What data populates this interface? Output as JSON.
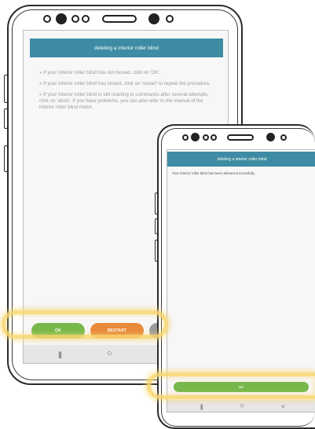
{
  "back_phone": {
    "header_title": "deleting a interior roller blind",
    "instructions": [
      "» If your interior roller blind has not moved, click on 'OK'.",
      "» If your interior roller blind has closed, click on 'restart' to repeat the procedure.",
      "» If your interior roller blind is still reacting to commands after several attempts, click on 'abort'. If you have problems, you can also refer to the manual of the interior roller blind motor."
    ],
    "ok_label": "OK",
    "restart_label": "RESTART",
    "nav": {
      "recent": "|||",
      "home": "○"
    }
  },
  "front_phone": {
    "header_title": "deleting a interior roller blind",
    "message": "Your interior roller blind has been deleted successfully.",
    "ok_label": "OK",
    "nav": {
      "recent": "|||",
      "home": "○",
      "back": "<"
    }
  },
  "colors": {
    "header": "#3e8ca3",
    "ok_button": "#76b84b",
    "restart_button": "#e9893a",
    "abort_button": "#9b9b9b",
    "highlight": "#f8d66e"
  }
}
